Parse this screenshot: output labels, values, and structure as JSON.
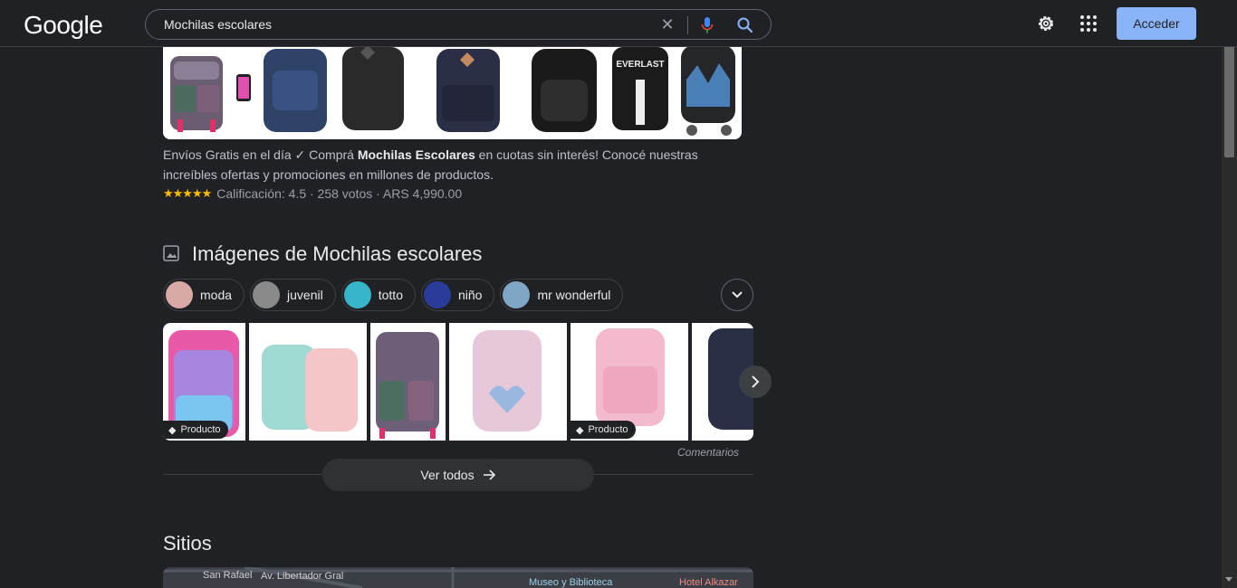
{
  "header": {
    "logo_text": "Google",
    "search_value": "Mochilas escolares",
    "signin_label": "Acceder"
  },
  "snippet": {
    "line_prefix": "Envíos Gratis en el día ✓ Comprá ",
    "bold": "Mochilas Escolares",
    "line_suffix": " en cuotas sin interés! Conocé nuestras increíbles ofertas y promociones en millones de productos.",
    "stars": "★★★★★",
    "rating_text": "Calificación: 4.5 · 258 votos · ARS 4,990.00"
  },
  "images_section": {
    "title": "Imágenes de Mochilas escolares",
    "chips": [
      {
        "label": "moda"
      },
      {
        "label": "juvenil"
      },
      {
        "label": "totto"
      },
      {
        "label": "niño"
      },
      {
        "label": "mr wonderful"
      }
    ],
    "product_badge": "Producto",
    "feedback": "Comentarios",
    "see_all": "Ver todos"
  },
  "sites_section": {
    "title": "Sitios",
    "map_labels": [
      "San Rafael",
      "Av. Libertador Gral",
      "Museo y Biblioteca",
      "Hotel Alkazar"
    ]
  }
}
